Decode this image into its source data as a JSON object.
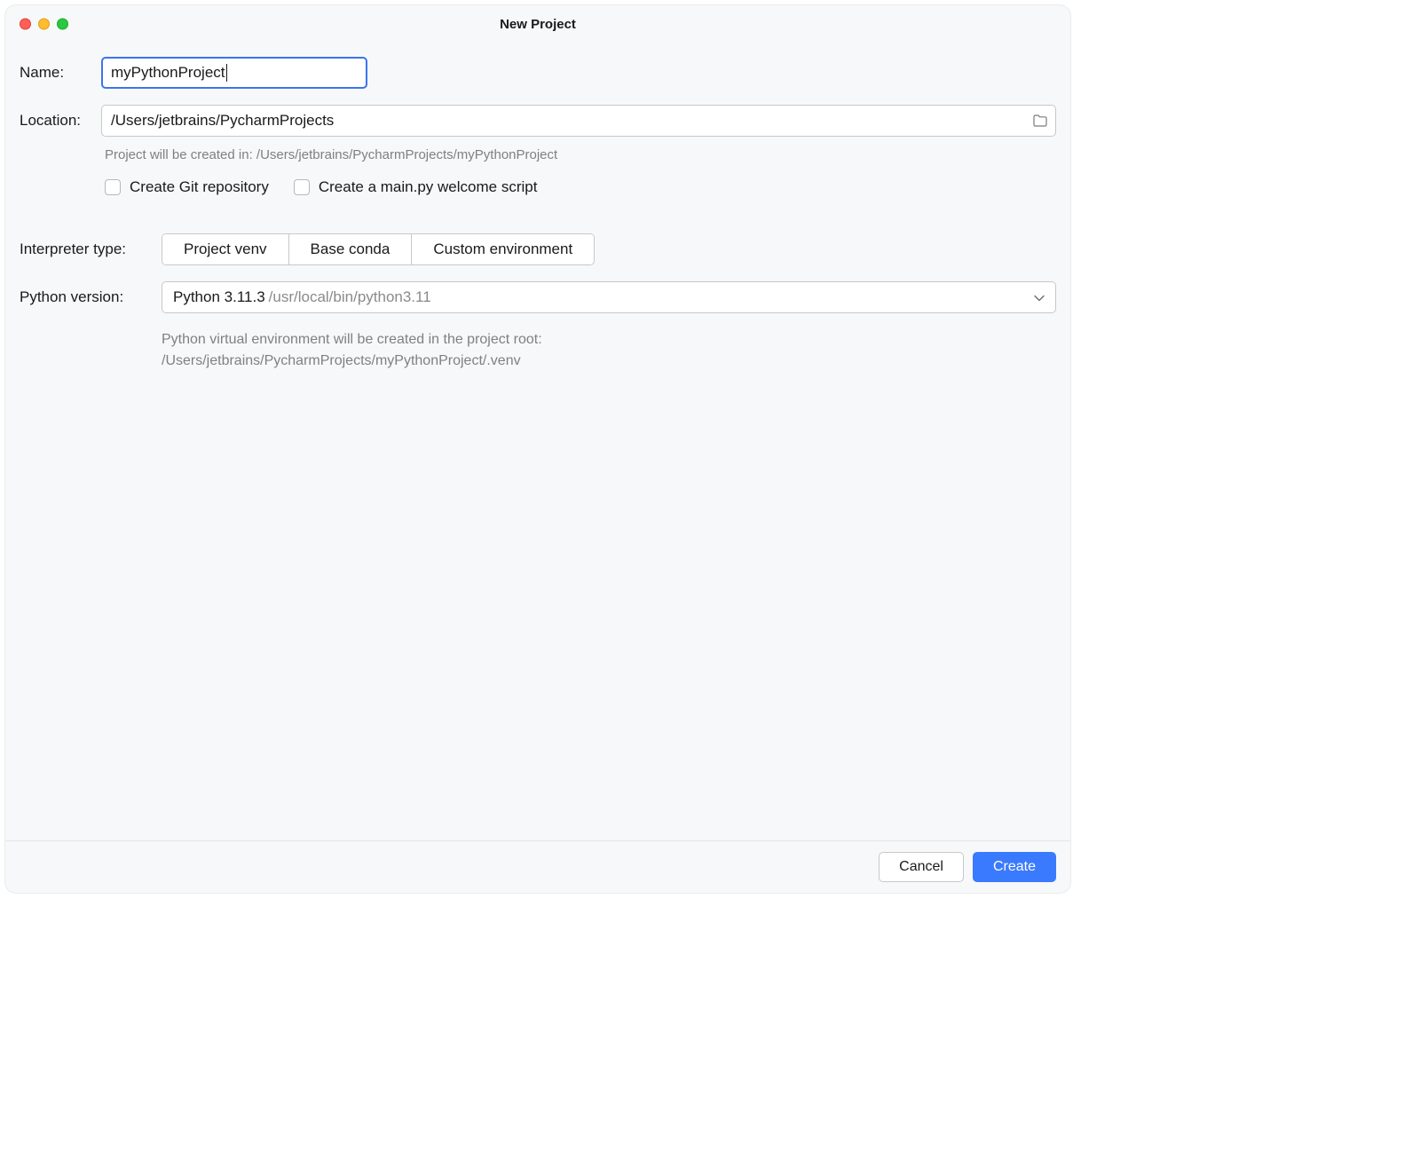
{
  "window": {
    "title": "New Project"
  },
  "name": {
    "label": "Name:",
    "value": "myPythonProject"
  },
  "location": {
    "label": "Location:",
    "value": "/Users/jetbrains/PycharmProjects"
  },
  "hint_created_in": "Project will be created in: /Users/jetbrains/PycharmProjects/myPythonProject",
  "checkboxes": {
    "git": "Create Git repository",
    "mainpy": "Create a main.py welcome script"
  },
  "interpreter_type": {
    "label": "Interpreter type:",
    "options": [
      "Project venv",
      "Base conda",
      "Custom environment"
    ],
    "selected": 0
  },
  "python_version": {
    "label": "Python version:",
    "value": "Python 3.11.3",
    "path": "/usr/local/bin/python3.11"
  },
  "venv_hint_line1": "Python virtual environment will be created in the project root:",
  "venv_hint_line2": "/Users/jetbrains/PycharmProjects/myPythonProject/.venv",
  "buttons": {
    "cancel": "Cancel",
    "create": "Create"
  }
}
